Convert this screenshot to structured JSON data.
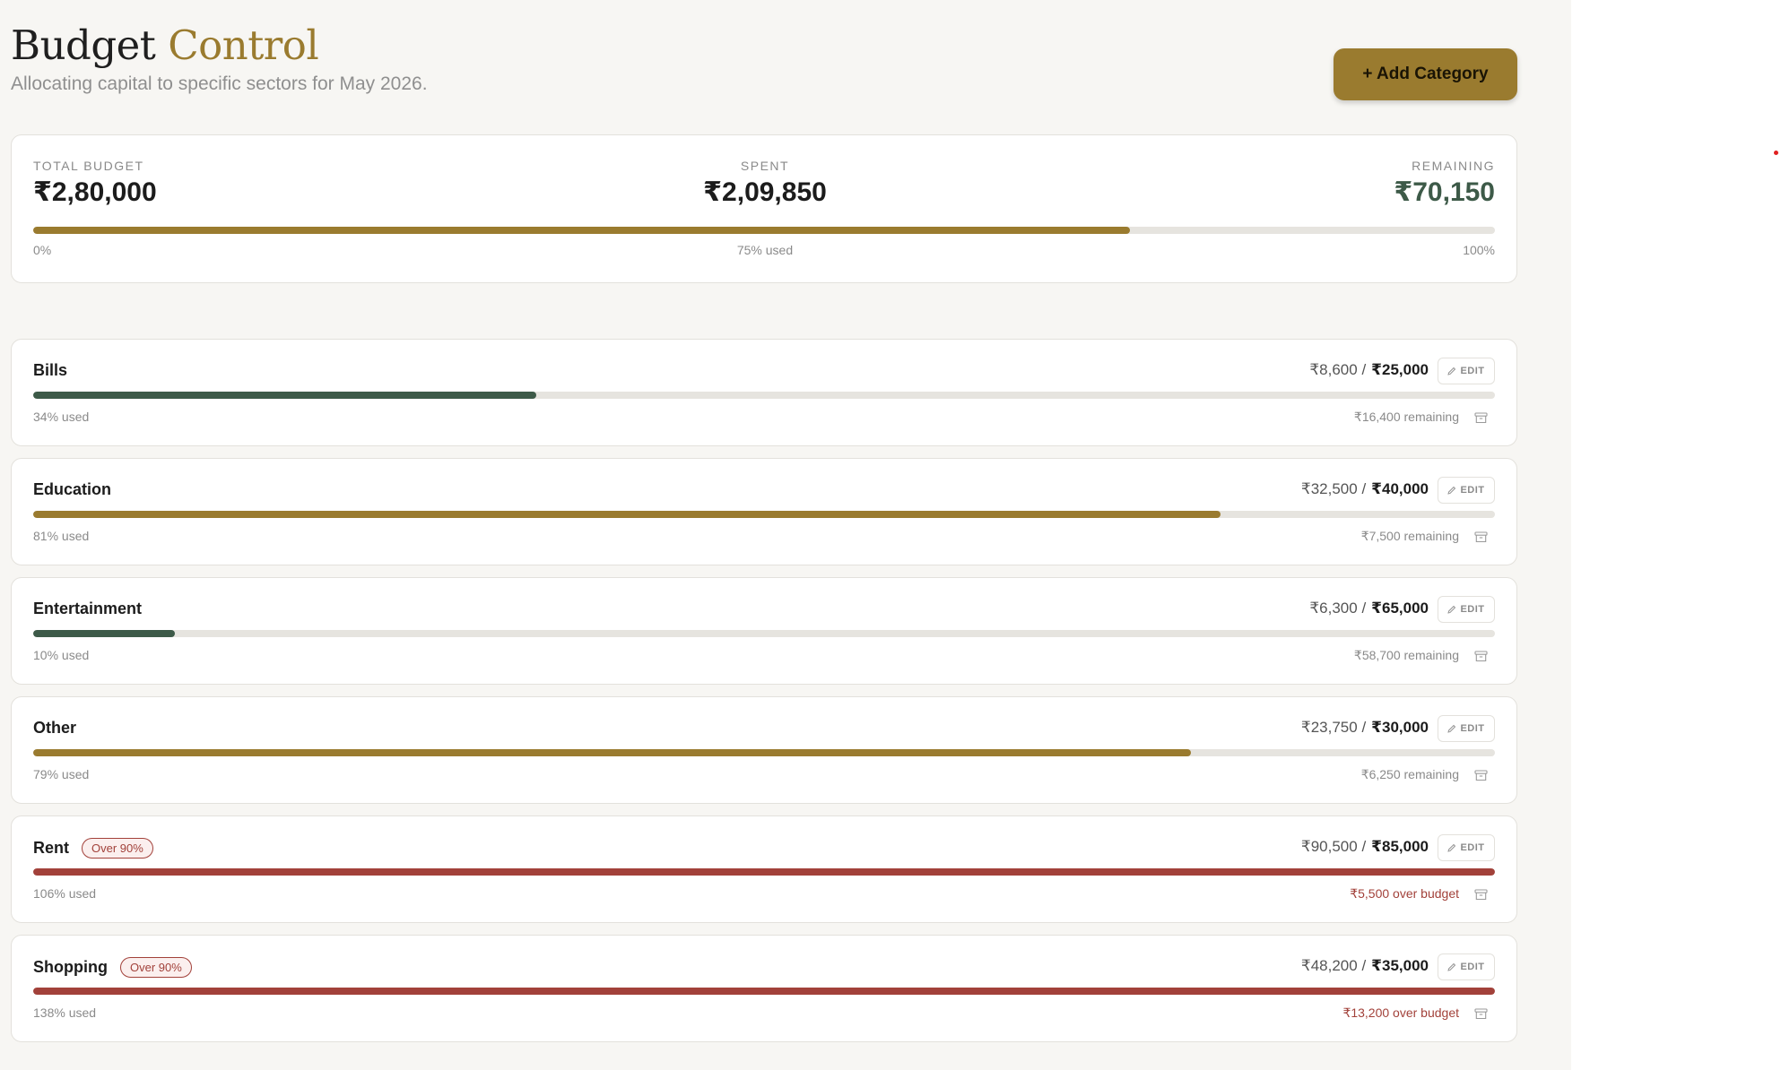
{
  "header": {
    "title_main": "Budget",
    "title_accent": "Control",
    "subtitle": "Allocating capital to specific sectors for May 2026.",
    "add_button": "+ Add Category"
  },
  "summary": {
    "total_label": "TOTAL BUDGET",
    "total_value": "₹2,80,000",
    "spent_label": "SPENT",
    "spent_value": "₹2,09,850",
    "remaining_label": "REMAINING",
    "remaining_value": "₹70,150",
    "progress_fraction": 0.75,
    "tick_start": "0%",
    "tick_mid": "75% used",
    "tick_end": "100%"
  },
  "edit_label": "EDIT",
  "colors": {
    "gold": "#9a7b2f",
    "green": "#3d5a48",
    "red": "#a2413a",
    "background": "#f7f6f3"
  },
  "categories": [
    {
      "name": "Bills",
      "badge": "",
      "spent": "₹8,600 /",
      "budget": "₹25,000",
      "used": "34% used",
      "remaining": "₹16,400 remaining",
      "fill_fraction": 0.344,
      "color": "green",
      "over": false
    },
    {
      "name": "Education",
      "badge": "",
      "spent": "₹32,500 /",
      "budget": "₹40,000",
      "used": "81% used",
      "remaining": "₹7,500 remaining",
      "fill_fraction": 0.8125,
      "color": "gold",
      "over": false
    },
    {
      "name": "Entertainment",
      "badge": "",
      "spent": "₹6,300 /",
      "budget": "₹65,000",
      "used": "10% used",
      "remaining": "₹58,700 remaining",
      "fill_fraction": 0.097,
      "color": "green",
      "over": false
    },
    {
      "name": "Other",
      "badge": "",
      "spent": "₹23,750 /",
      "budget": "₹30,000",
      "used": "79% used",
      "remaining": "₹6,250 remaining",
      "fill_fraction": 0.792,
      "color": "gold",
      "over": false
    },
    {
      "name": "Rent",
      "badge": "Over 90%",
      "spent": "₹90,500 /",
      "budget": "₹85,000",
      "used": "106% used",
      "remaining": "₹5,500 over budget",
      "fill_fraction": 1.0,
      "color": "red",
      "over": true
    },
    {
      "name": "Shopping",
      "badge": "Over 90%",
      "spent": "₹48,200 /",
      "budget": "₹35,000",
      "used": "138% used",
      "remaining": "₹13,200 over budget",
      "fill_fraction": 1.0,
      "color": "red",
      "over": true
    }
  ]
}
